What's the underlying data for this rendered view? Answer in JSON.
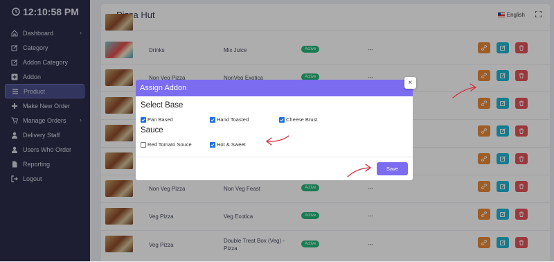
{
  "sidebar": {
    "clock": "12:10:58 PM",
    "items": [
      {
        "label": "Dashboard",
        "icon": "home-icon",
        "has_chevron": true
      },
      {
        "label": "Category",
        "icon": "edit-icon",
        "has_chevron": false
      },
      {
        "label": "Addon Category",
        "icon": "edit-icon",
        "has_chevron": false
      },
      {
        "label": "Addon",
        "icon": "plus-square-icon",
        "has_chevron": false
      },
      {
        "label": "Product",
        "icon": "list-icon",
        "has_chevron": false,
        "active": true
      },
      {
        "label": "Make New Order",
        "icon": "plus-icon",
        "has_chevron": false
      },
      {
        "label": "Manage Orders",
        "icon": "cart-icon",
        "has_chevron": true
      },
      {
        "label": "Delivery Staff",
        "icon": "user-icon",
        "has_chevron": false
      },
      {
        "label": "Users Who Order",
        "icon": "user-icon",
        "has_chevron": false
      },
      {
        "label": "Reporting",
        "icon": "file-icon",
        "has_chevron": false
      },
      {
        "label": "Logout",
        "icon": "logout-icon",
        "has_chevron": false
      }
    ]
  },
  "header": {
    "title": "Pizza Hut",
    "language": "English"
  },
  "table": {
    "rows": [
      {
        "category": "Drinks",
        "name": "Mix Juice",
        "status": "Active",
        "extra": "---"
      },
      {
        "category": "Non Veg Pizza",
        "name": "NonVeg Exotica",
        "status": "Active",
        "extra": "---"
      },
      {
        "category": "",
        "name": "",
        "status": "",
        "extra": "---"
      },
      {
        "category": "",
        "name": "",
        "status": "",
        "extra": "---"
      },
      {
        "category": "",
        "name": "",
        "status": "",
        "extra": "---"
      },
      {
        "category": "Non Veg Pizza",
        "name": "Non Veg Feast",
        "status": "Active",
        "extra": "---"
      },
      {
        "category": "Veg Pizza",
        "name": "Veg Exotica",
        "status": "Active",
        "extra": "---"
      },
      {
        "category": "Veg Pizza",
        "name": "Double Treat Box (Veg) - Pizza",
        "status": "Active",
        "extra": "---"
      }
    ]
  },
  "modal": {
    "title": "Assign Addon",
    "close_label": "×",
    "sections": [
      {
        "title": "Select Base",
        "options": [
          {
            "label": "Pan Based",
            "checked": true
          },
          {
            "label": "Hand Toasted",
            "checked": true
          },
          {
            "label": "Cheese Brust",
            "checked": true
          }
        ]
      },
      {
        "title": "Sauce",
        "options": [
          {
            "label": "Red Tomato Souce",
            "checked": false
          },
          {
            "label": "Hot & Sweet",
            "checked": true
          }
        ]
      }
    ],
    "save_label": "Save"
  },
  "colors": {
    "sidebar_bg": "#2b2d4a",
    "accent": "#7b6cf0",
    "active_badge": "#26b67a",
    "link_button": "#e8893a",
    "edit_button": "#1fb6d1",
    "delete_button": "#e3545b",
    "annotation_arrow": "#d62c3c"
  }
}
